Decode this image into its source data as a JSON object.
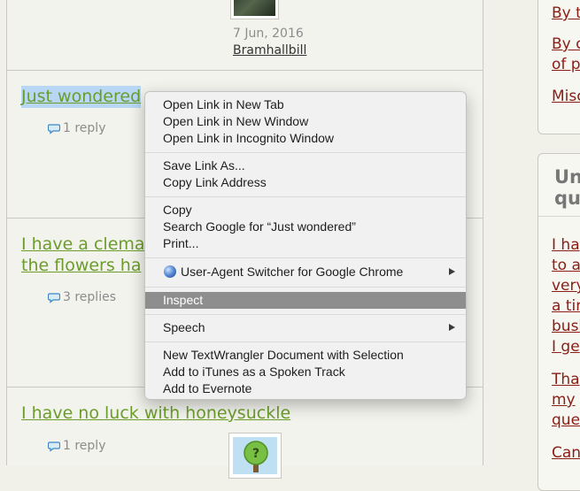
{
  "forum": {
    "row1": {
      "date": "7 Jun, 2016",
      "user": "Bramhallbill"
    },
    "row2": {
      "title": "Just wondered",
      "replies": "1 reply"
    },
    "row3": {
      "title_line1": "I have a clema",
      "title_line2": "the flowers ha",
      "replies": "3 replies"
    },
    "row4": {
      "title": "I have no luck with honeysuckle",
      "replies": "1 reply"
    }
  },
  "sidebar": {
    "box1_links": [
      "By t",
      "By c",
      "of p",
      "Misc"
    ],
    "box2_heading": [
      "Un",
      "qu"
    ],
    "box2_lines": [
      "I ha",
      "to a",
      "very",
      "a tin",
      "bush",
      "I ge",
      "Tha",
      "my",
      "que",
      "Can"
    ]
  },
  "context_menu": {
    "items": [
      "Open Link in New Tab",
      "Open Link in New Window",
      "Open Link in Incognito Window",
      "Save Link As...",
      "Copy Link Address",
      "Copy",
      "Search Google for “Just wondered”",
      "Print...",
      "User-Agent Switcher for Google Chrome",
      "Inspect",
      "Speech",
      "New TextWrangler Document with Selection",
      "Add to iTunes as a Spoken Track",
      "Add to Evernote"
    ],
    "highlighted": "Inspect"
  },
  "colors": {
    "topic_link": "#6c9c2c",
    "sidebar_link": "#8a1d14",
    "selection": "#b7d7f4",
    "menu_highlight": "#8e8e8e"
  },
  "icons": [
    "speech-bubble-icon",
    "user-agent-globe-icon",
    "submenu-arrow-icon",
    "avatar-tree-icon"
  ]
}
